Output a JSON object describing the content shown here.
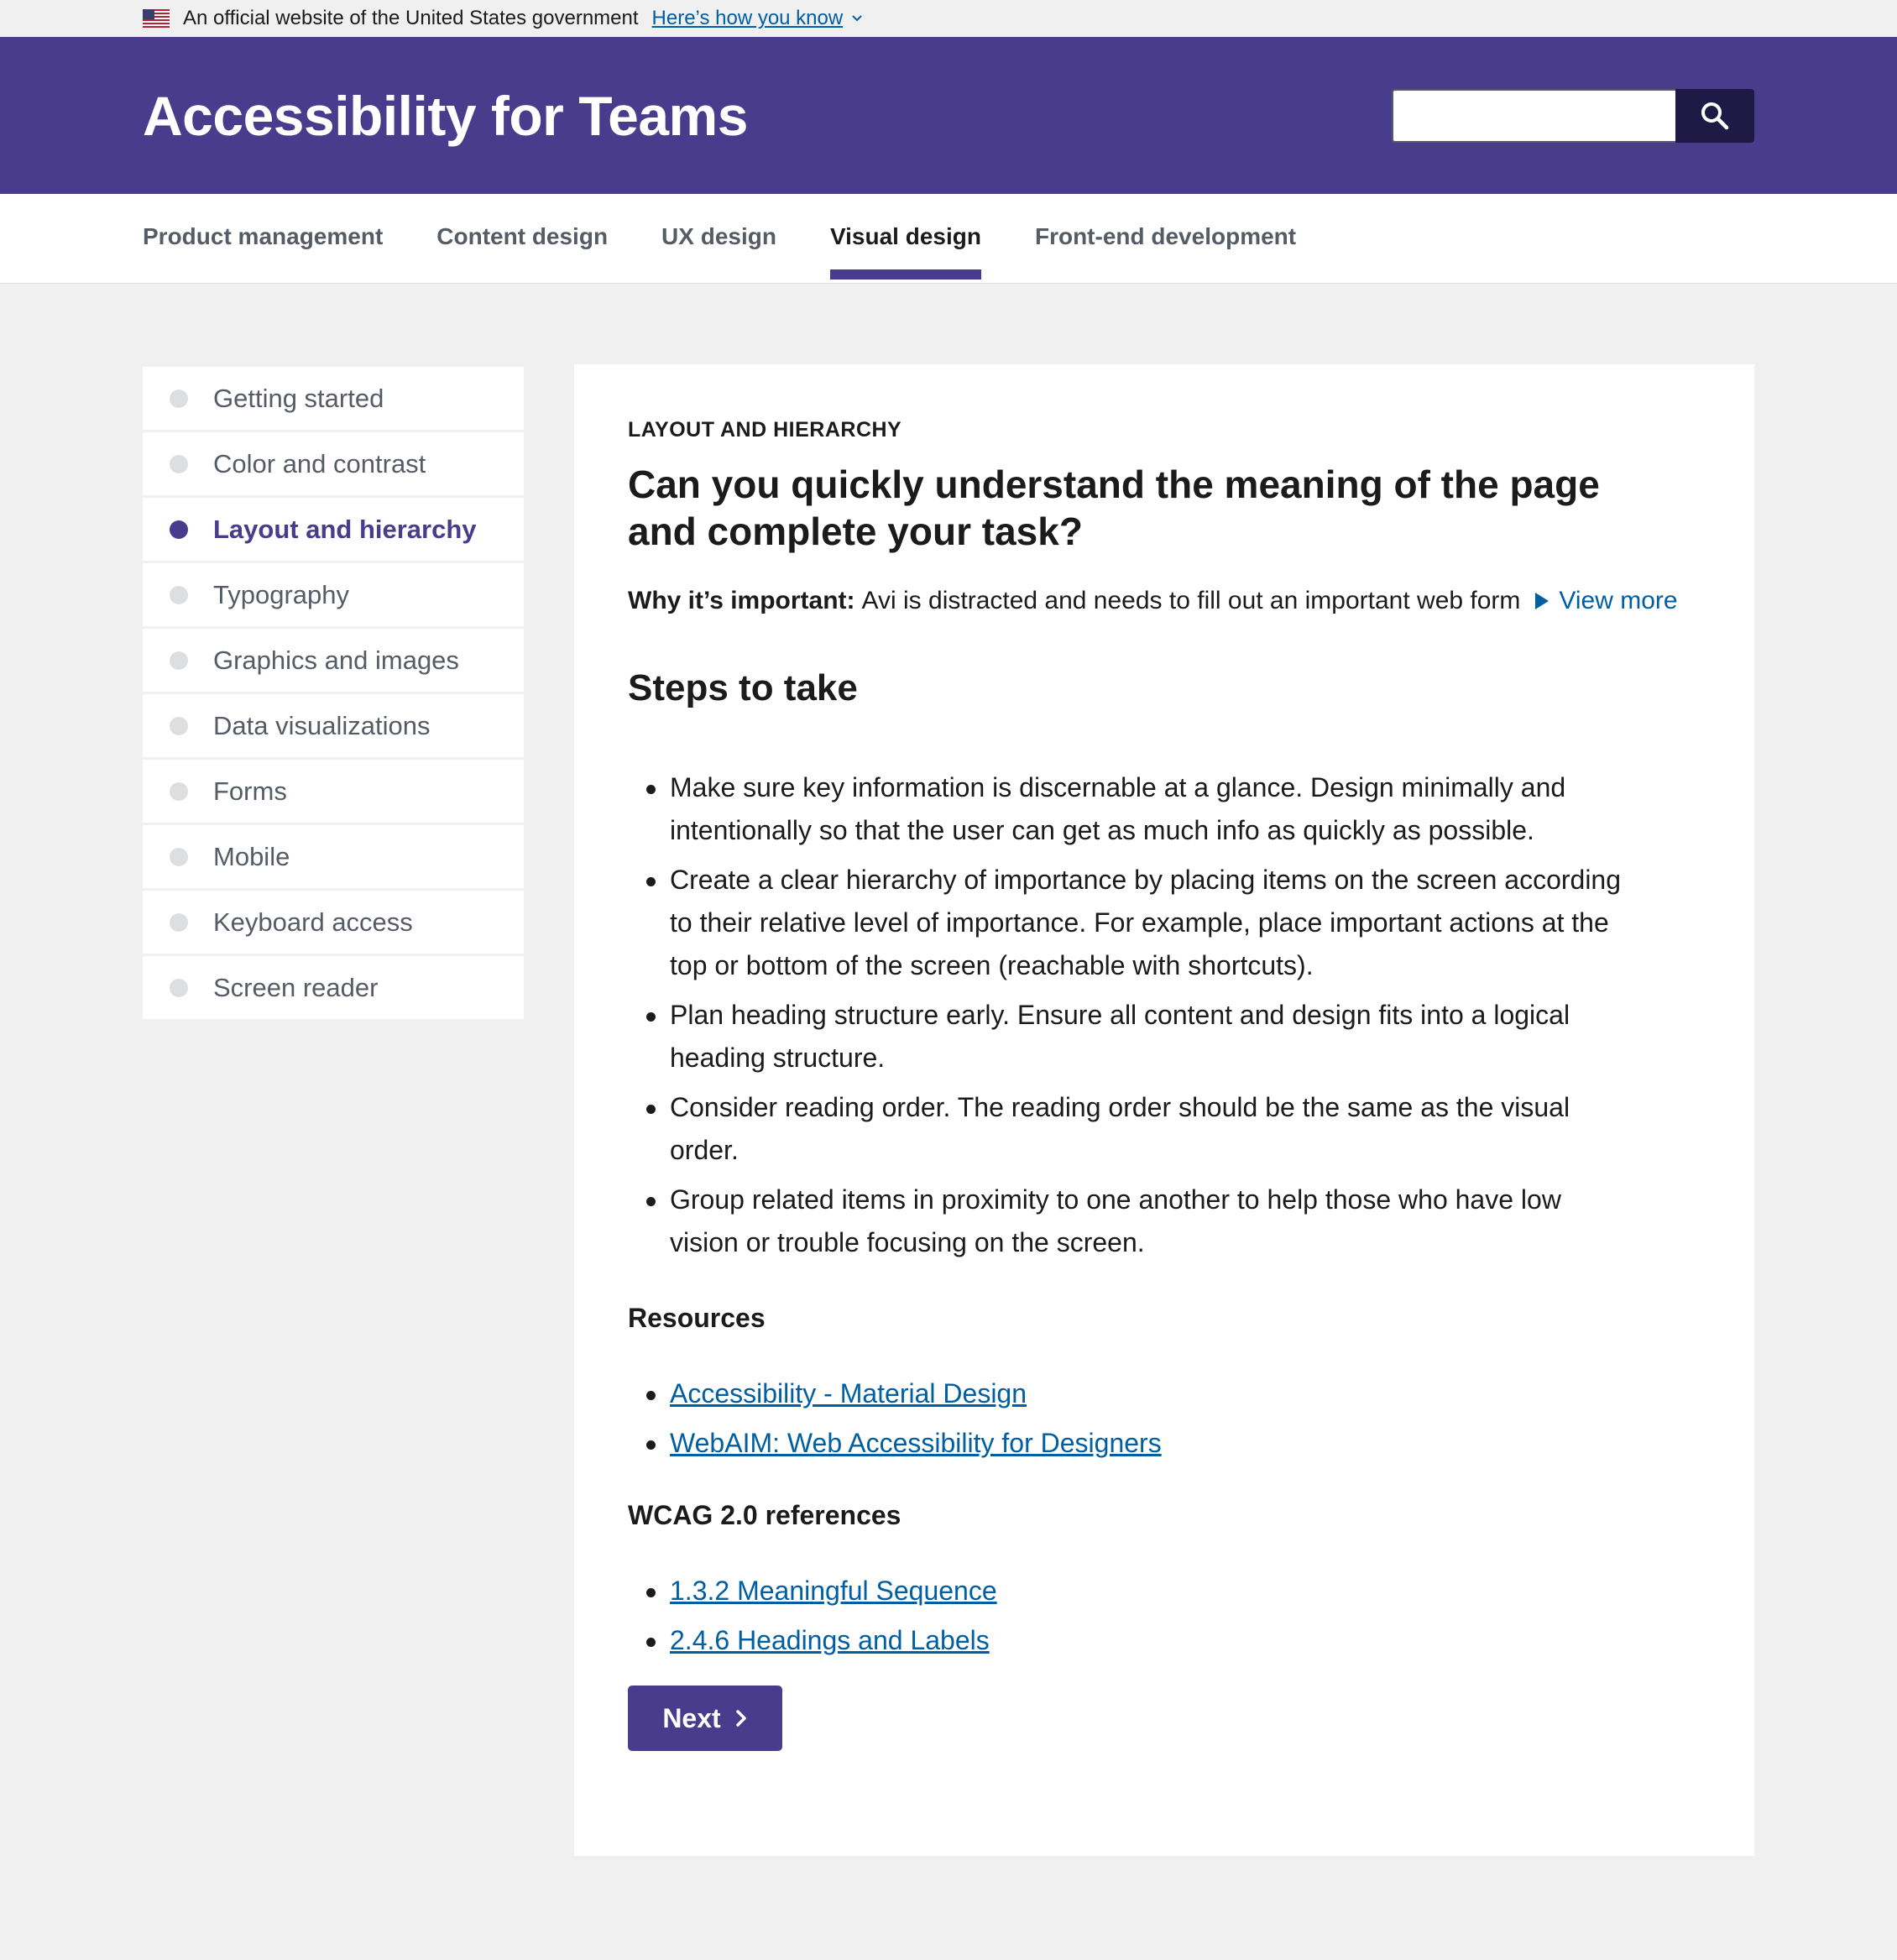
{
  "gov_banner": {
    "text": "An official website of the United States government",
    "link_label": "Here’s how you know",
    "flag_icon": "us-flag-icon"
  },
  "header": {
    "title": "Accessibility for Teams",
    "search_placeholder": "",
    "search_icon": "search-icon",
    "colors": {
      "brand": "#4a3c8c",
      "search_button": "#1f1a45"
    }
  },
  "nav": {
    "items": [
      {
        "label": "Product management",
        "active": false
      },
      {
        "label": "Content design",
        "active": false
      },
      {
        "label": "UX design",
        "active": false
      },
      {
        "label": "Visual design",
        "active": true
      },
      {
        "label": "Front-end development",
        "active": false
      }
    ]
  },
  "sidebar": {
    "items": [
      {
        "label": "Getting started",
        "active": false
      },
      {
        "label": "Color and contrast",
        "active": false
      },
      {
        "label": "Layout and hierarchy",
        "active": true
      },
      {
        "label": "Typography",
        "active": false
      },
      {
        "label": "Graphics and images",
        "active": false
      },
      {
        "label": "Data visualizations",
        "active": false
      },
      {
        "label": "Forms",
        "active": false
      },
      {
        "label": "Mobile",
        "active": false
      },
      {
        "label": "Keyboard access",
        "active": false
      },
      {
        "label": "Screen reader",
        "active": false
      }
    ]
  },
  "content": {
    "eyebrow": "LAYOUT AND HIERARCHY",
    "question": "Can you quickly understand the meaning of the page and complete your task?",
    "why_label": "Why it’s important:",
    "why_text": "Avi is distracted and needs to fill out an important web form",
    "view_more": "View more",
    "steps_title": "Steps to take",
    "steps": [
      "Make sure key information is discernable at a glance. Design minimally and intentionally so that the user can get as much info as quickly as possible.",
      "Create a clear hierarchy of importance by placing items on the screen according to their relative level of importance. For example, place important actions at the top or bottom of the screen (reachable with shortcuts).",
      "Plan heading structure early. Ensure all content and design fits into a logical heading structure.",
      "Consider reading order. The reading order should be the same as the visual order.",
      "Group related items in proximity to one another to help those who have low vision or trouble focusing on the screen."
    ],
    "resources_title": "Resources",
    "resources": [
      "Accessibility - Material Design",
      "WebAIM: Web Accessibility for Designers"
    ],
    "wcag_title": "WCAG 2.0 references",
    "wcag": [
      "1.3.2 Meaningful Sequence",
      "2.4.6 Headings and Labels"
    ],
    "next_label": "Next",
    "colors": {
      "link": "#005ea2",
      "accent": "#4a3c8c"
    }
  }
}
